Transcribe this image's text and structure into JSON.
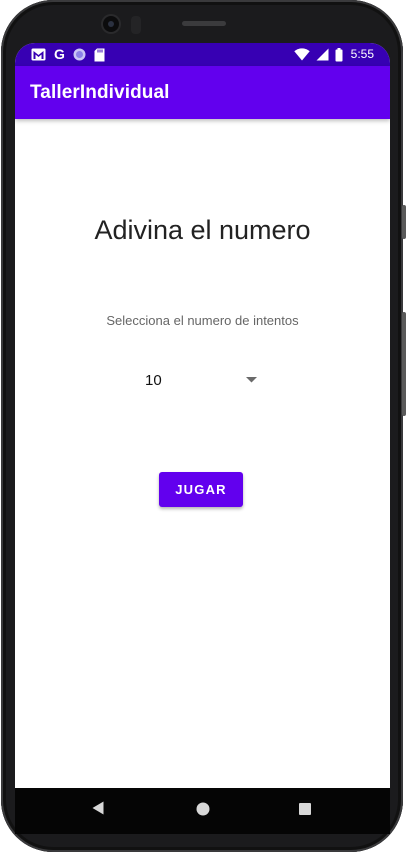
{
  "status_bar": {
    "notifications": [
      "gmail-icon",
      "google-icon",
      "circle-app-icon",
      "sd-card-icon"
    ],
    "google_letter": "G",
    "time": "5:55",
    "indicators": [
      "wifi-icon",
      "cellular-signal-icon",
      "battery-icon"
    ]
  },
  "app_bar": {
    "title": "TallerIndividual"
  },
  "main": {
    "heading": "Adivina el numero",
    "subtitle": "Selecciona el numero de intentos",
    "attempts_spinner": {
      "selected": "10"
    },
    "play_button_label": "JUGAR"
  },
  "nav_bar": {
    "buttons": [
      "back-icon",
      "home-icon",
      "recents-icon"
    ]
  },
  "colors": {
    "primary": "#6200ee",
    "primary_dark": "#3700b3",
    "text_primary": "#222222",
    "text_secondary": "#666666"
  }
}
